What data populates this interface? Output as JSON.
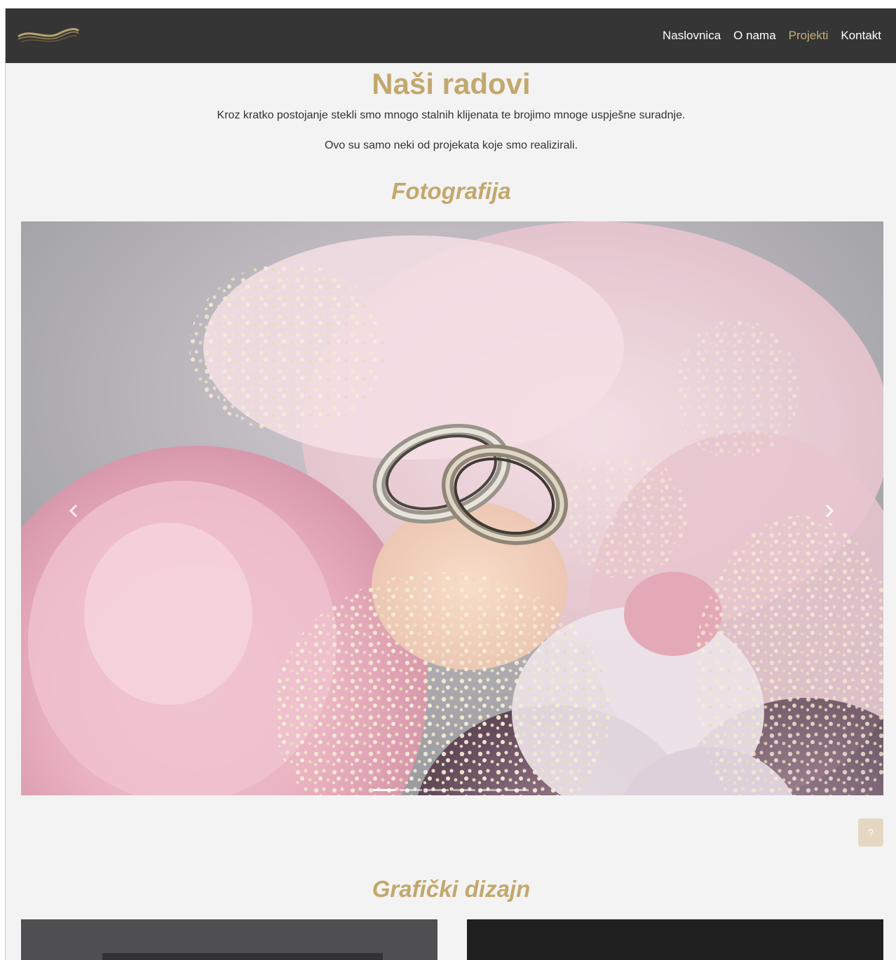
{
  "nav": {
    "logo_icon": "gold-wave-logo",
    "items": [
      {
        "label": "Naslovnica",
        "active": false
      },
      {
        "label": "O nama",
        "active": false
      },
      {
        "label": "Projekti",
        "active": true
      },
      {
        "label": "Kontakt",
        "active": false
      }
    ]
  },
  "header": {
    "title": "Naši radovi",
    "intro_1": "Kroz kratko postojanje stekli smo mnogo stalnih klijenata te brojimo mnoge uspješne suradnje.",
    "intro_2": "Ovo su samo neki od projekata koje smo realizirali."
  },
  "sections": {
    "photography": {
      "title": "Fotografija"
    },
    "graphic_design": {
      "title": "Grafički dizajn"
    }
  },
  "carousel": {
    "prev_icon": "chevron-left-icon",
    "next_icon": "chevron-right-icon",
    "slide_count": 6,
    "active_index": 0
  },
  "help_button": {
    "label": "?"
  },
  "colors": {
    "navbar": "#353535",
    "accent_gold": "#c2a86d",
    "background": "#f3f3f3"
  }
}
